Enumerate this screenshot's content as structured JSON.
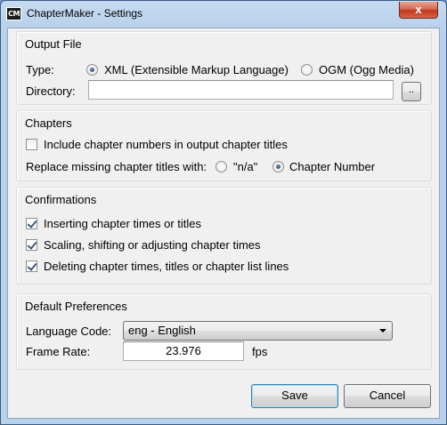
{
  "window": {
    "icon_text": "CM",
    "title": "ChapterMaker - Settings",
    "close_glyph": "x"
  },
  "output_file": {
    "group_title": "Output File",
    "type_label": "Type:",
    "options": [
      {
        "label": "XML (Extensible Markup Language)",
        "selected": true
      },
      {
        "label": "OGM (Ogg Media)",
        "selected": false
      }
    ],
    "directory_label": "Directory:",
    "directory_value": "",
    "browse_label": ".."
  },
  "chapters": {
    "group_title": "Chapters",
    "include_numbers_label": "Include chapter numbers in output chapter titles",
    "include_numbers_checked": false,
    "replace_label": "Replace missing chapter titles with:",
    "replace_options": [
      {
        "label": "\"n/a\"",
        "selected": false
      },
      {
        "label": "Chapter Number",
        "selected": true
      }
    ]
  },
  "confirmations": {
    "group_title": "Confirmations",
    "items": [
      {
        "label": "Inserting chapter times or titles",
        "checked": true
      },
      {
        "label": "Scaling, shifting or adjusting chapter times",
        "checked": true
      },
      {
        "label": "Deleting chapter times, titles or chapter list lines",
        "checked": true
      }
    ]
  },
  "preferences": {
    "group_title": "Default Preferences",
    "language_label": "Language Code:",
    "language_value": "eng - English",
    "frame_rate_label": "Frame Rate:",
    "frame_rate_value": "23.976",
    "frame_rate_unit": "fps"
  },
  "buttons": {
    "save": "Save",
    "cancel": "Cancel"
  }
}
